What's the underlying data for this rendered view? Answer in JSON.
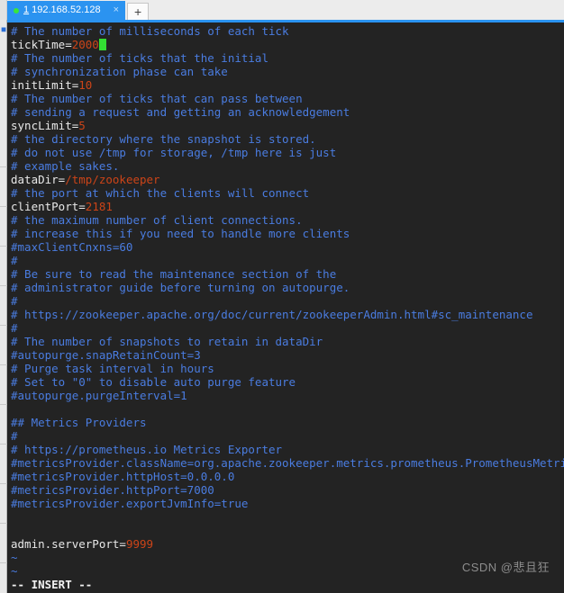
{
  "window": {
    "tabbar": {
      "tab": {
        "index": "1",
        "title": "192.168.52.128",
        "close_label": "×",
        "status_dot": "connected"
      },
      "new_tab_label": "+"
    },
    "accent_color": "#2b93f0",
    "tab_text_color": "#ffffff",
    "status_dot_color": "#39e639"
  },
  "terminal": {
    "background_color": "#232323",
    "comment_color": "#4a7ce0",
    "key_color": "#e8e8e8",
    "value_color": "#cc4418",
    "cursor_color": "#33dd33",
    "lines": [
      {
        "type": "comment",
        "text": "# The number of milliseconds of each tick"
      },
      {
        "type": "kv",
        "key": "tickTime=",
        "value": "2000",
        "cursor": true
      },
      {
        "type": "comment",
        "text": "# The number of ticks that the initial"
      },
      {
        "type": "comment",
        "text": "# synchronization phase can take"
      },
      {
        "type": "kv",
        "key": "initLimit=",
        "value": "10"
      },
      {
        "type": "comment",
        "text": "# The number of ticks that can pass between"
      },
      {
        "type": "comment",
        "text": "# sending a request and getting an acknowledgement"
      },
      {
        "type": "kv",
        "key": "syncLimit=",
        "value": "5"
      },
      {
        "type": "comment",
        "text": "# the directory where the snapshot is stored."
      },
      {
        "type": "comment",
        "text": "# do not use /tmp for storage, /tmp here is just"
      },
      {
        "type": "comment",
        "text": "# example sakes."
      },
      {
        "type": "kv",
        "key": "dataDir=",
        "value": "/tmp/zookeeper"
      },
      {
        "type": "comment",
        "text": "# the port at which the clients will connect"
      },
      {
        "type": "kv",
        "key": "clientPort=",
        "value": "2181"
      },
      {
        "type": "comment",
        "text": "# the maximum number of client connections."
      },
      {
        "type": "comment",
        "text": "# increase this if you need to handle more clients"
      },
      {
        "type": "comment",
        "text": "#maxClientCnxns=60"
      },
      {
        "type": "comment",
        "text": "#"
      },
      {
        "type": "comment",
        "text": "# Be sure to read the maintenance section of the"
      },
      {
        "type": "comment",
        "text": "# administrator guide before turning on autopurge."
      },
      {
        "type": "comment",
        "text": "#"
      },
      {
        "type": "comment",
        "text": "# https://zookeeper.apache.org/doc/current/zookeeperAdmin.html#sc_maintenance"
      },
      {
        "type": "comment",
        "text": "#"
      },
      {
        "type": "comment",
        "text": "# The number of snapshots to retain in dataDir"
      },
      {
        "type": "comment",
        "text": "#autopurge.snapRetainCount=3"
      },
      {
        "type": "comment",
        "text": "# Purge task interval in hours"
      },
      {
        "type": "comment",
        "text": "# Set to \"0\" to disable auto purge feature"
      },
      {
        "type": "comment",
        "text": "#autopurge.purgeInterval=1"
      },
      {
        "type": "blank",
        "text": ""
      },
      {
        "type": "comment",
        "text": "## Metrics Providers"
      },
      {
        "type": "comment",
        "text": "#"
      },
      {
        "type": "comment",
        "text": "# https://prometheus.io Metrics Exporter"
      },
      {
        "type": "comment",
        "text": "#metricsProvider.className=org.apache.zookeeper.metrics.prometheus.PrometheusMetric"
      },
      {
        "type": "comment",
        "text": "#metricsProvider.httpHost=0.0.0.0"
      },
      {
        "type": "comment",
        "text": "#metricsProvider.httpPort=7000"
      },
      {
        "type": "comment",
        "text": "#metricsProvider.exportJvmInfo=true"
      },
      {
        "type": "blank",
        "text": ""
      },
      {
        "type": "blank",
        "text": ""
      },
      {
        "type": "kv",
        "key": "admin.serverPort=",
        "value": "9999"
      },
      {
        "type": "tilde",
        "text": "~"
      },
      {
        "type": "tilde",
        "text": "~"
      },
      {
        "type": "status",
        "text": "-- INSERT --"
      }
    ]
  },
  "watermark": {
    "text": "CSDN @悲且狂"
  }
}
